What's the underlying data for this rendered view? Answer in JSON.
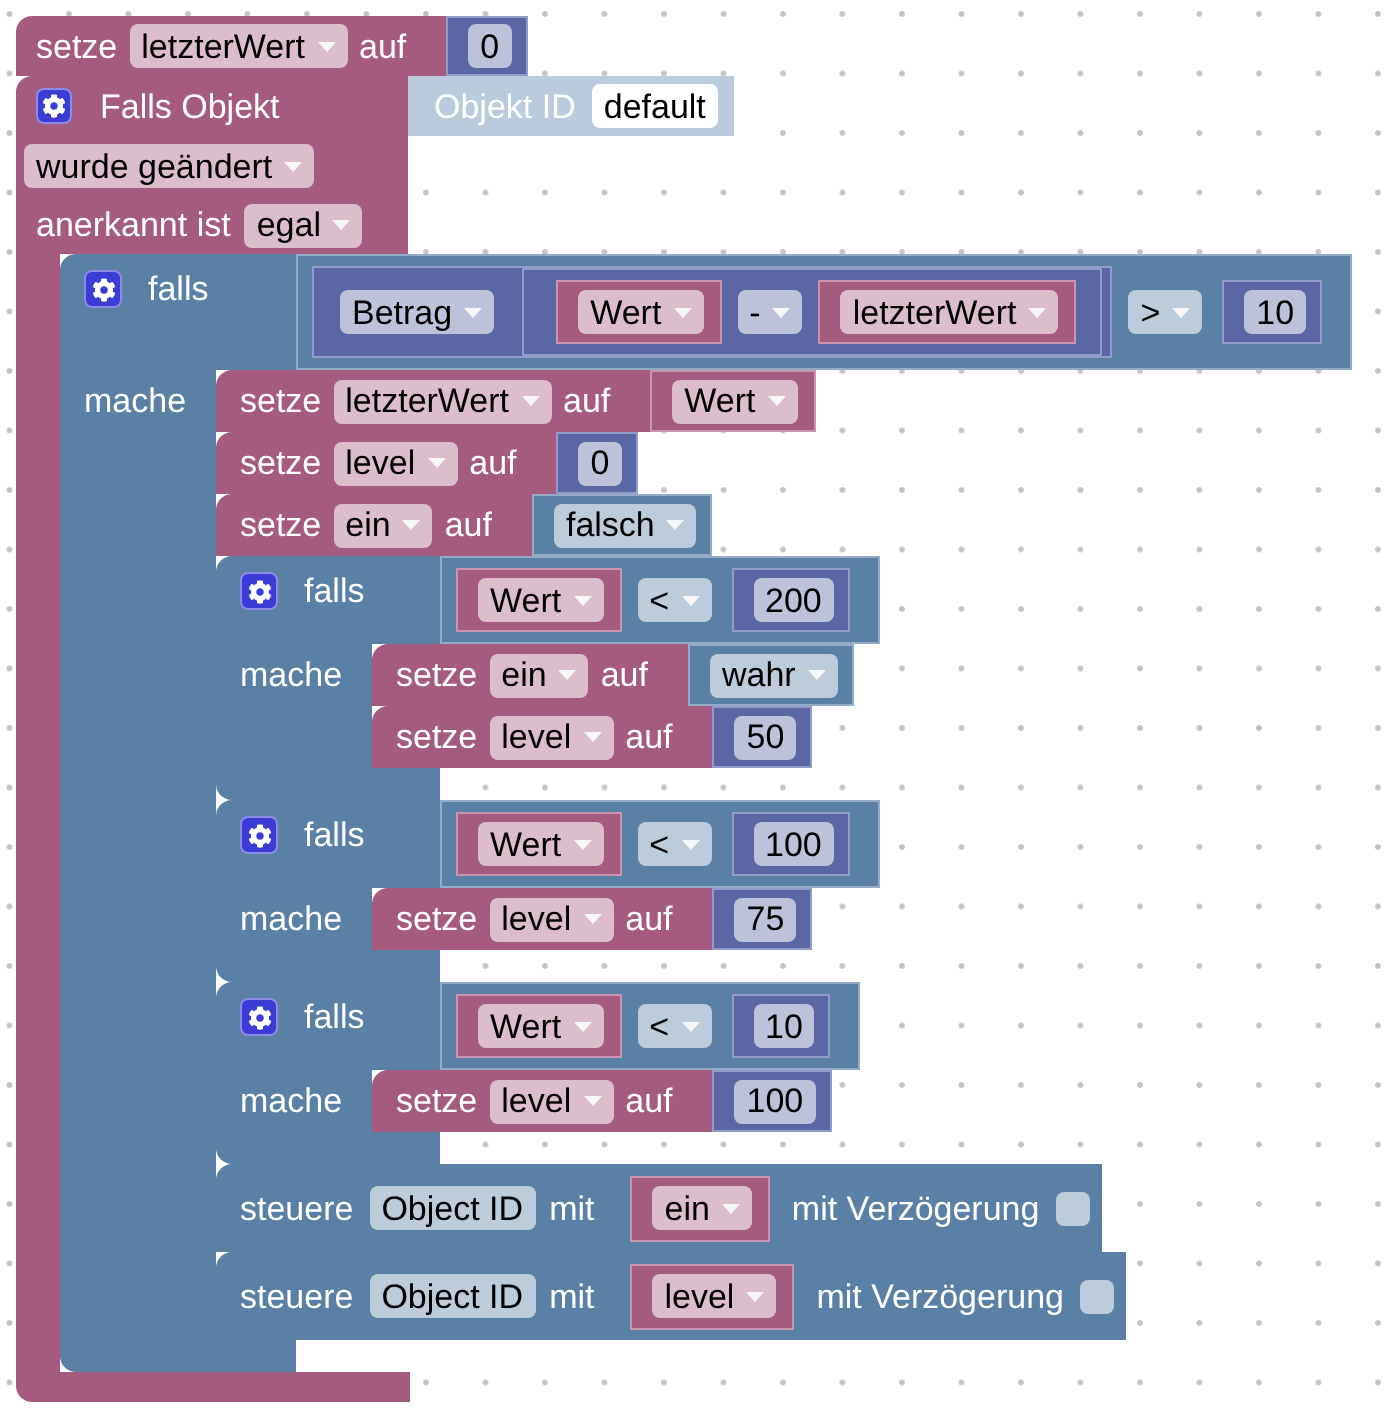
{
  "workspace": {
    "blocks": [
      {
        "kind": "set_variable",
        "label": "setze",
        "variable": "letzterWert",
        "to_label": "auf",
        "value": {
          "kind": "number",
          "value": "0"
        }
      },
      {
        "kind": "trigger",
        "label": "Falls Objekt",
        "object": {
          "kind": "object_id",
          "label": "Objekt ID",
          "value": "default"
        },
        "event": "wurde geändert",
        "ack_label": "anerkannt ist",
        "ack": "egal",
        "statements": [
          {
            "kind": "if",
            "label": "falls",
            "do_label": "mache",
            "condition": {
              "kind": "compare",
              "left": {
                "kind": "math_single",
                "operator": "Betrag",
                "operand": {
                  "kind": "arithmetic",
                  "left": {
                    "kind": "variable",
                    "name": "Wert"
                  },
                  "operator": "-",
                  "right": {
                    "kind": "variable",
                    "name": "letzterWert"
                  }
                }
              },
              "operator": ">",
              "right": {
                "kind": "number",
                "value": "10"
              }
            },
            "statements": [
              {
                "kind": "set_variable",
                "label": "setze",
                "variable": "letzterWert",
                "to_label": "auf",
                "value": {
                  "kind": "variable",
                  "name": "Wert"
                }
              },
              {
                "kind": "set_variable",
                "label": "setze",
                "variable": "level",
                "to_label": "auf",
                "value": {
                  "kind": "number",
                  "value": "0"
                }
              },
              {
                "kind": "set_variable",
                "label": "setze",
                "variable": "ein",
                "to_label": "auf",
                "value": {
                  "kind": "boolean",
                  "value": "falsch"
                }
              },
              {
                "kind": "if",
                "label": "falls",
                "do_label": "mache",
                "condition": {
                  "kind": "compare",
                  "left": {
                    "kind": "variable",
                    "name": "Wert"
                  },
                  "operator": "<",
                  "right": {
                    "kind": "number",
                    "value": "200"
                  }
                },
                "statements": [
                  {
                    "kind": "set_variable",
                    "label": "setze",
                    "variable": "ein",
                    "to_label": "auf",
                    "value": {
                      "kind": "boolean",
                      "value": "wahr"
                    }
                  },
                  {
                    "kind": "set_variable",
                    "label": "setze",
                    "variable": "level",
                    "to_label": "auf",
                    "value": {
                      "kind": "number",
                      "value": "50"
                    }
                  }
                ]
              },
              {
                "kind": "if",
                "label": "falls",
                "do_label": "mache",
                "condition": {
                  "kind": "compare",
                  "left": {
                    "kind": "variable",
                    "name": "Wert"
                  },
                  "operator": "<",
                  "right": {
                    "kind": "number",
                    "value": "100"
                  }
                },
                "statements": [
                  {
                    "kind": "set_variable",
                    "label": "setze",
                    "variable": "level",
                    "to_label": "auf",
                    "value": {
                      "kind": "number",
                      "value": "75"
                    }
                  }
                ]
              },
              {
                "kind": "if",
                "label": "falls",
                "do_label": "mache",
                "condition": {
                  "kind": "compare",
                  "left": {
                    "kind": "variable",
                    "name": "Wert"
                  },
                  "operator": "<",
                  "right": {
                    "kind": "number",
                    "value": "10"
                  }
                },
                "statements": [
                  {
                    "kind": "set_variable",
                    "label": "setze",
                    "variable": "level",
                    "to_label": "auf",
                    "value": {
                      "kind": "number",
                      "value": "100"
                    }
                  }
                ]
              },
              {
                "kind": "control",
                "label": "steuere",
                "object": "Object ID",
                "with_label": "mit",
                "value": {
                  "kind": "variable",
                  "name": "ein"
                },
                "delay_label": "mit Verzögerung",
                "delay": false
              },
              {
                "kind": "control",
                "label": "steuere",
                "object": "Object ID",
                "with_label": "mit",
                "value": {
                  "kind": "variable",
                  "name": "level"
                },
                "delay_label": "mit Verzögerung",
                "delay": false
              }
            ]
          }
        ]
      }
    ]
  }
}
